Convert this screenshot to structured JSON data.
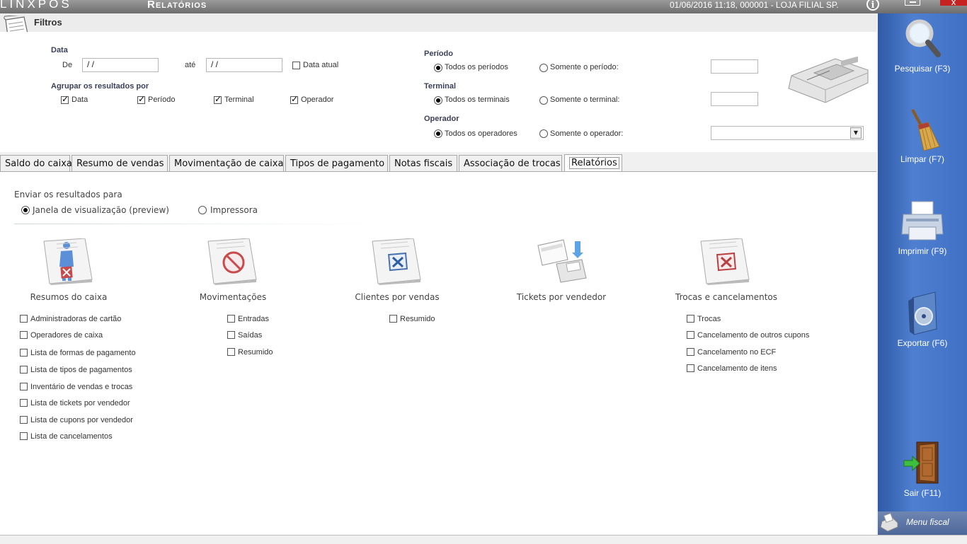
{
  "titlebar": {
    "logo": "LINXPOS",
    "screen_title": "Relatórios",
    "status": "01/06/2016 11:18, 000001 - LOJA FILIAL SP.",
    "info_glyph": "i",
    "close_glyph": "x"
  },
  "filters": {
    "header": "Filtros",
    "date": {
      "section": "Data",
      "from_label": "De",
      "from_value": " / /",
      "to_label": "até",
      "to_value": " / /",
      "current_label": "Data atual",
      "current_checked": false
    },
    "group_by": {
      "section": "Agrupar os resultados por",
      "options": [
        {
          "label": "Data",
          "checked": true
        },
        {
          "label": "Período",
          "checked": true
        },
        {
          "label": "Terminal",
          "checked": true
        },
        {
          "label": "Operador",
          "checked": true
        }
      ]
    },
    "period": {
      "section": "Período",
      "all_label": "Todos os períodos",
      "only_label": "Somente o período:",
      "selected": "all"
    },
    "terminal": {
      "section": "Terminal",
      "all_label": "Todos os terminais",
      "only_label": "Somente o terminal:",
      "selected": "all"
    },
    "operator": {
      "section": "Operador",
      "all_label": "Todos os operadores",
      "only_label": "Somente o operador:",
      "selected": "all"
    }
  },
  "tabs": [
    {
      "label": "Saldo do caixa",
      "active": false
    },
    {
      "label": "Resumo de vendas",
      "active": false
    },
    {
      "label": "Movimentação de caixa",
      "active": false
    },
    {
      "label": "Tipos de pagamento",
      "active": false
    },
    {
      "label": "Notas fiscais",
      "active": false
    },
    {
      "label": "Associação de trocas",
      "active": false
    },
    {
      "label": "Relatórios",
      "active": true
    }
  ],
  "reports": {
    "send_to_label": "Enviar os resultados para",
    "preview_label": "Janela de visualização (preview)",
    "printer_label": "Impressora",
    "send_selected": "preview",
    "groups": [
      {
        "title": "Resumos do caixa",
        "icon": "person-report-icon",
        "options": [
          "Administradoras de cartão",
          "Operadores de caixa",
          "Lista de formas de pagamento",
          "Lista de tipos de pagamentos",
          "Inventário de vendas e trocas",
          "Lista de tickets por vendedor",
          "Lista de cupons por vendedor",
          "Lista de cancelamentos"
        ]
      },
      {
        "title": "Movimentações",
        "icon": "prohibited-report-icon",
        "options": [
          "Entradas",
          "Saídas",
          "Resumido"
        ]
      },
      {
        "title": "Clientes por vendas",
        "icon": "blue-x-report-icon",
        "options": [
          "Resumido"
        ]
      },
      {
        "title": "Tickets por vendedor",
        "icon": "credit-card-receipt-icon",
        "options": []
      },
      {
        "title": "Trocas e cancelamentos",
        "icon": "red-x-report-icon",
        "options": [
          "Trocas",
          "Cancelamento de outros cupons",
          "Cancelamento no ECF",
          "Cancelamento de itens"
        ]
      }
    ]
  },
  "sidebar": {
    "search": "Pesquisar (F3)",
    "clear": "Limpar (F7)",
    "print": "Imprimir (F9)",
    "export": "Exportar (F6)",
    "exit": "Sair (F11)",
    "menu_fiscal": "Menu fiscal"
  },
  "colors": {
    "sidebar": "#3f6fc2",
    "titlebar": "#7a7a7a",
    "section_label": "#3a3f5a"
  }
}
